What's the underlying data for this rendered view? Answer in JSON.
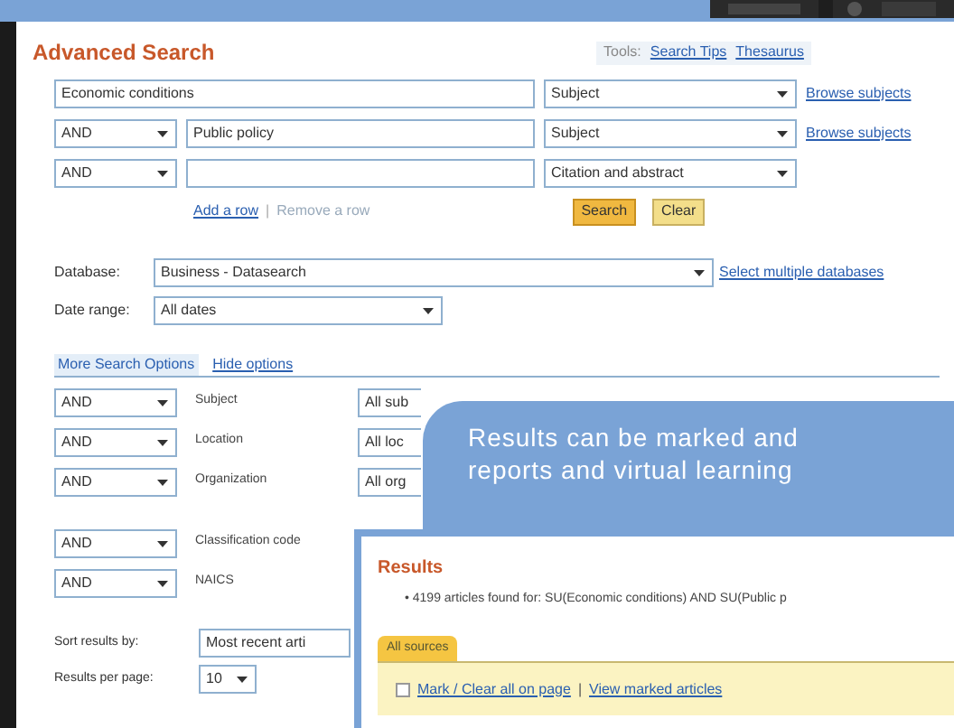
{
  "header": {
    "title": "Advanced Search",
    "tools_label": "Tools:",
    "links": [
      "Search Tips",
      "Thesaurus"
    ]
  },
  "search_rows": [
    {
      "term": "Economic conditions",
      "field": "Subject",
      "link": "Browse subjects"
    },
    {
      "operator": "AND",
      "term": "Public policy",
      "field": "Subject",
      "link": "Browse subjects"
    },
    {
      "operator": "AND",
      "field": "Citation and abstract"
    }
  ],
  "row_links": [
    "Add a row",
    "|",
    "Remove a row"
  ],
  "buttons": [
    "Search",
    "Clear"
  ],
  "database": {
    "label": "Database:",
    "value": "Business - Datasearch",
    "link": "Select multiple databases"
  },
  "date_range": {
    "label": "Date range:",
    "value": "All dates"
  },
  "options_header": {
    "title": "More Search Options",
    "link": "Hide options"
  },
  "option_rows": [
    {
      "operator": "AND",
      "label": "Subject",
      "value": "All sub"
    },
    {
      "operator": "AND",
      "label": "Location",
      "value": "All loc"
    },
    {
      "operator": "AND",
      "label": "Organization",
      "value": "All org"
    },
    {
      "operator": "AND",
      "label": "Classification code"
    },
    {
      "operator": "AND",
      "label": "NAICS"
    }
  ],
  "sort": {
    "label": "Sort results by:",
    "value": "Most recent arti"
  },
  "per_page": {
    "label": "Results per page:",
    "value": "10"
  },
  "callout": {
    "lines": [
      "Results can be marked and",
      "reports and virtual learning"
    ]
  },
  "results": {
    "title": "Results",
    "summary": "• 4199 articles found for: SU(Economic conditions) AND SU(Public p",
    "tab": "All sources",
    "checked": false,
    "mark": "Mark / Clear all on page",
    "separator": "|",
    "view": "View marked articles"
  }
}
